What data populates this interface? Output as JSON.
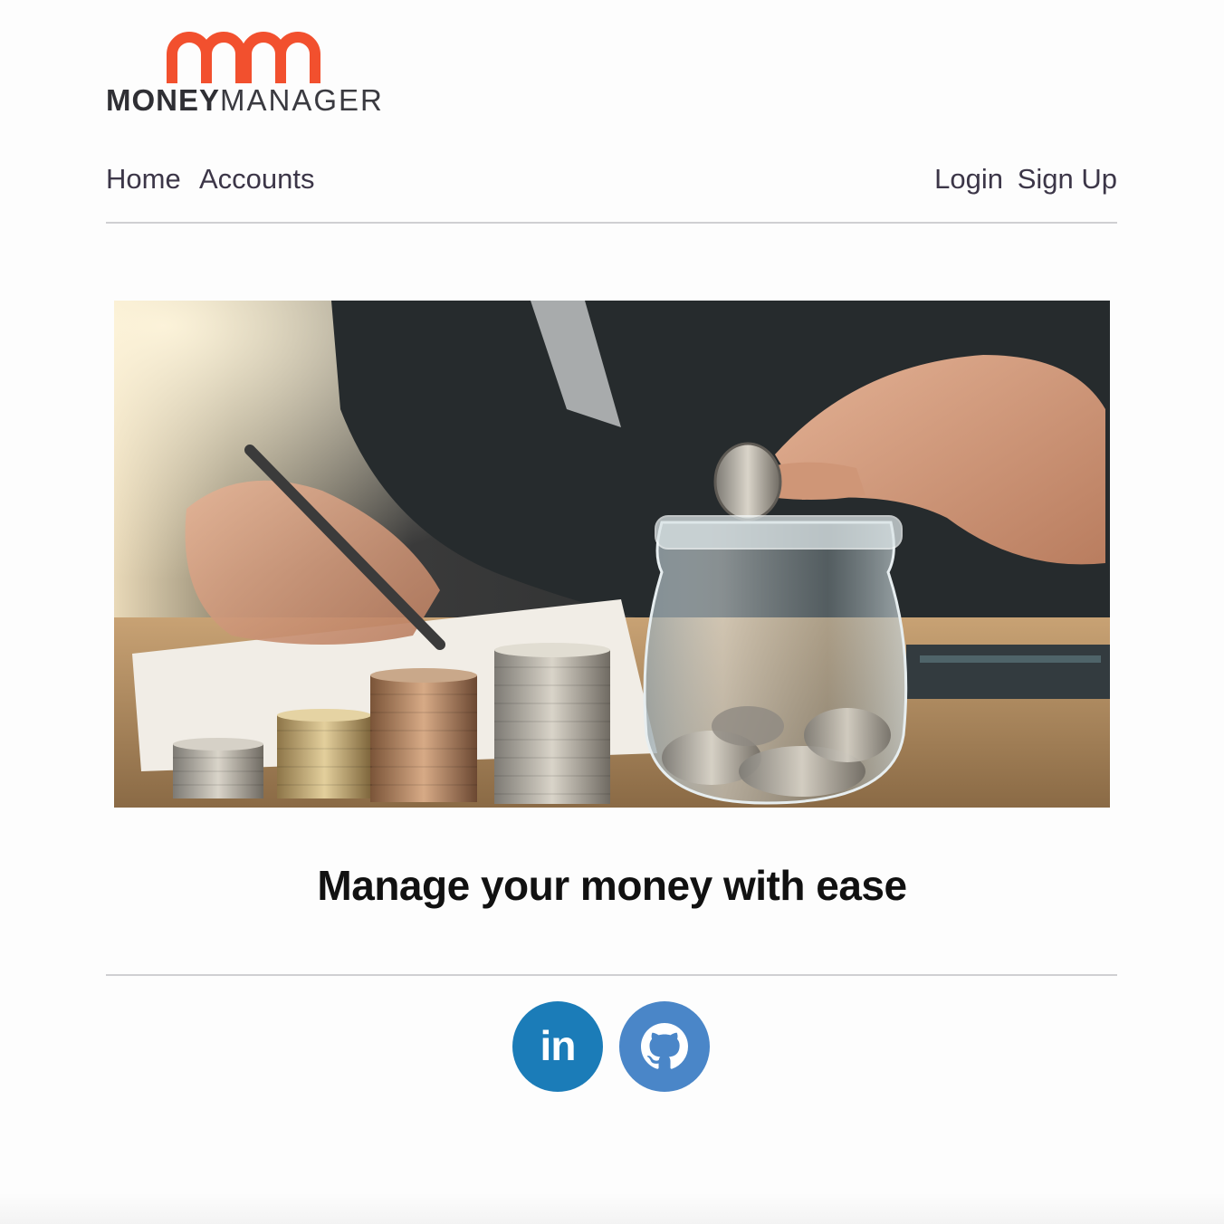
{
  "brand": {
    "wordmark_bold": "MONEY",
    "wordmark_light": "MANAGER",
    "logo_color": "#f2502e"
  },
  "nav": {
    "home": "Home",
    "accounts": "Accounts",
    "login": "Login",
    "signup": "Sign Up"
  },
  "hero": {
    "tagline": "Manage your money with ease"
  },
  "social": {
    "linkedin_label": "in",
    "linkedin_icon": "linkedin-icon",
    "github_icon": "github-icon"
  }
}
